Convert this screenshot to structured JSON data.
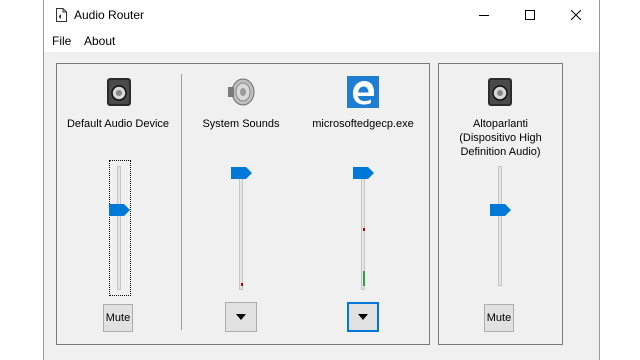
{
  "window": {
    "title": "Audio Router",
    "controls": {
      "minimize": "minimize-icon",
      "maximize": "maximize-icon",
      "close": "close-icon"
    }
  },
  "menu": {
    "items": [
      "File",
      "About"
    ]
  },
  "devices": [
    {
      "label": "Default Audio Device",
      "icon": "speaker-icon",
      "level": 0.7,
      "button": "Mute"
    },
    {
      "label": "Altoparlanti\n(Dispositivo High\nDefinition Audio)",
      "icon": "speaker-icon",
      "level": 0.7,
      "button": "Mute"
    }
  ],
  "apps": [
    {
      "label": "System Sounds",
      "icon": "speaker-cone-icon",
      "level": 1.0,
      "button_icon": "dropdown-arrow-icon"
    },
    {
      "label": "microsoftedgecp.exe",
      "icon": "edge-icon",
      "level": 1.0,
      "button_icon": "dropdown-arrow-icon"
    }
  ],
  "colors": {
    "accent": "#0078d7",
    "meter_red": "#c00000",
    "meter_green": "#2ea043"
  }
}
